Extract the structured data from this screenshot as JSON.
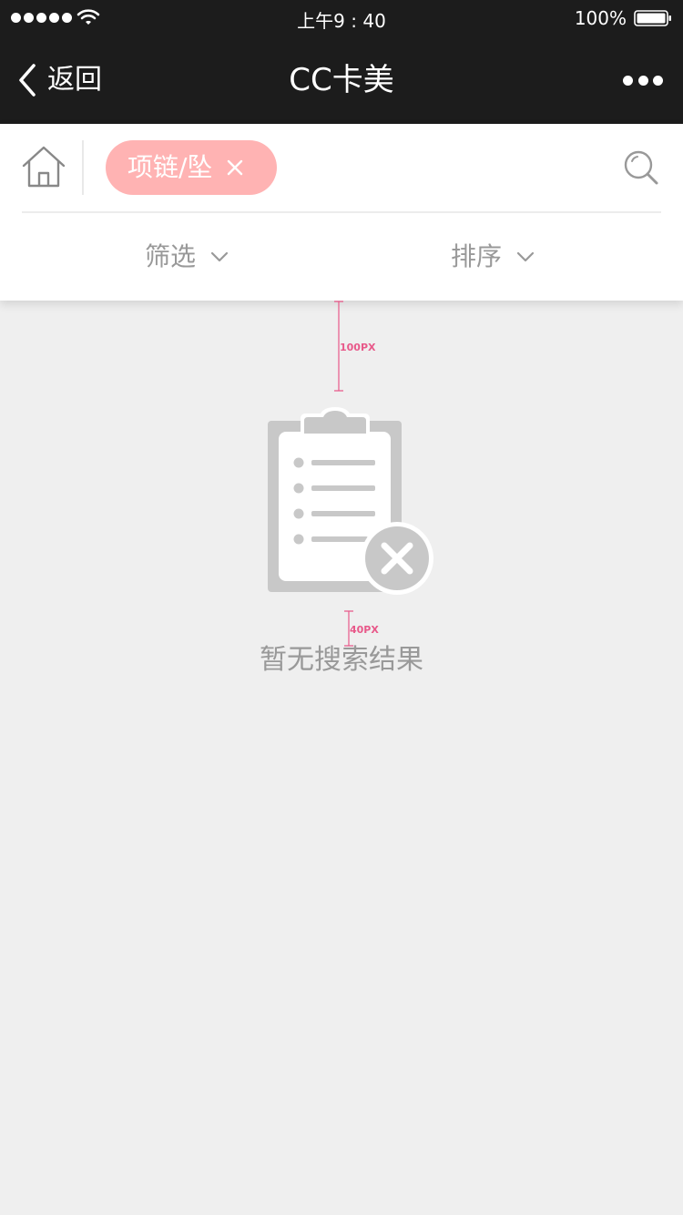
{
  "status_bar": {
    "time": "上午9 : 40",
    "battery_percent": "100%",
    "signal_icon": "signal-dots-icon",
    "wifi_icon": "wifi-icon",
    "battery_icon": "battery-icon"
  },
  "nav_bar": {
    "back_label": "返回",
    "back_icon": "chevron-left-icon",
    "title": "CC卡美",
    "more_icon": "more-dots-icon"
  },
  "header": {
    "home_icon": "home-icon",
    "tag_label": "项链/坠",
    "tag_close_icon": "close-icon",
    "search_icon": "search-icon",
    "filter_label": "筛选",
    "sort_label": "排序",
    "dropdown_icon": "chevron-down-icon"
  },
  "spec": {
    "top_gap": "100PX",
    "text_gap": "40PX",
    "marker_color": "#e8598a"
  },
  "empty_state": {
    "icon": "clipboard-error-icon",
    "message": "暂无搜索结果"
  },
  "colors": {
    "nav_bg": "#1c1c1c",
    "tag_bg": "#ffb3b3",
    "page_bg": "#efefef",
    "muted_text": "#999999"
  }
}
